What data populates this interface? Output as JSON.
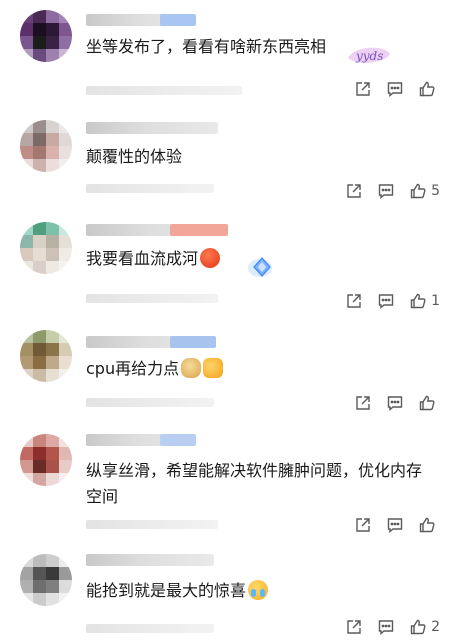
{
  "comments": [
    {
      "text": "坐等发布了，看看有啥新东西亮相",
      "sticker": "yyds",
      "actions": {
        "share_icon": "share-icon",
        "reply_icon": "comment-icon",
        "like_icon": "thumbs-up-icon",
        "like_count": ""
      }
    },
    {
      "text": "颠覆性的体验",
      "actions": {
        "share_icon": "share-icon",
        "reply_icon": "comment-icon",
        "like_icon": "thumbs-up-icon",
        "like_count": "5"
      }
    },
    {
      "text": "我要看血流成河",
      "emoji": "angry-face-icon",
      "actions": {
        "share_icon": "share-icon",
        "reply_icon": "comment-icon",
        "like_icon": "thumbs-up-icon",
        "like_count": "1"
      }
    },
    {
      "text": "cpu再给力点",
      "emoji": [
        "doge-icon",
        "fearful-face-icon"
      ],
      "actions": {
        "share_icon": "share-icon",
        "reply_icon": "comment-icon",
        "like_icon": "thumbs-up-icon",
        "like_count": ""
      }
    },
    {
      "text": "纵享丝滑，希望能解决软件臃肿问题，优化内存空间",
      "actions": {
        "share_icon": "share-icon",
        "reply_icon": "comment-icon",
        "like_icon": "thumbs-up-icon",
        "like_count": ""
      }
    },
    {
      "text": "能抢到就是最大的惊喜",
      "emoji": "crying-face-icon",
      "actions": {
        "share_icon": "share-icon",
        "reply_icon": "comment-icon",
        "like_icon": "thumbs-up-icon",
        "like_count": "2"
      }
    }
  ],
  "colors": {
    "text": "#1a1a1a",
    "icon": "#5a5a5a",
    "blur_name": "#d4d4d4",
    "blur_meta": "#e8e8e8"
  }
}
